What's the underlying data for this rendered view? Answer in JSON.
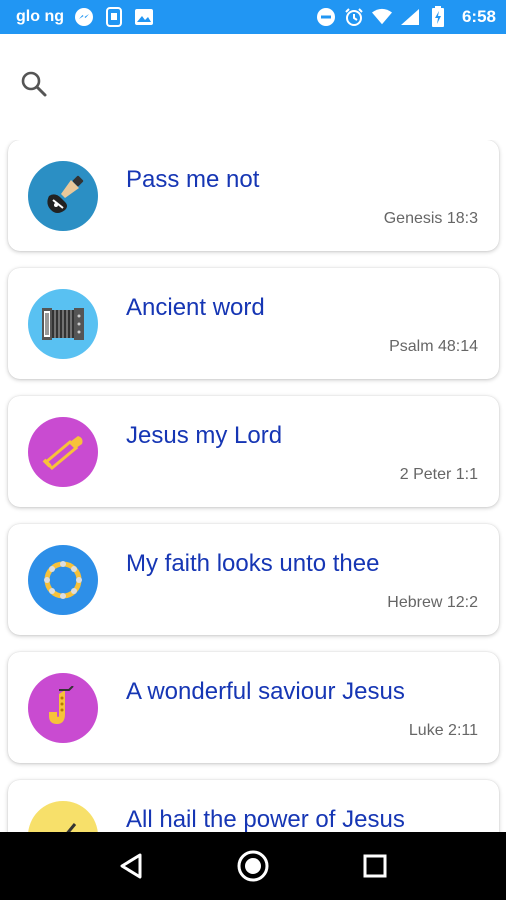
{
  "status_bar": {
    "carrier": "glo ng",
    "time": "6:58",
    "left_icons": [
      "messenger-icon",
      "sim-toolkit-icon",
      "image-icon"
    ],
    "right_icons": [
      "dnd-icon",
      "alarm-icon",
      "wifi-icon",
      "signal-icon",
      "battery-icon"
    ],
    "color": "#2196F3"
  },
  "search": {
    "icon": "search-icon"
  },
  "songs": [
    {
      "title": "Pass me not",
      "reference": "Genesis 18:3",
      "icon": "guitar-icon",
      "color": "#2b8fc4"
    },
    {
      "title": "Ancient word",
      "reference": "Psalm 48:14",
      "icon": "accordion-icon",
      "color": "#59c1f2"
    },
    {
      "title": "Jesus my Lord",
      "reference": "2 Peter 1:1",
      "icon": "trombone-icon",
      "color": "#c94bd1"
    },
    {
      "title": "My faith looks unto thee",
      "reference": "Hebrew 12:2",
      "icon": "tambourine-icon",
      "color": "#2d8fe8"
    },
    {
      "title": "A wonderful saviour Jesus",
      "reference": "Luke 2:11",
      "icon": "saxophone-icon",
      "color": "#c94bd1"
    },
    {
      "title": "All hail the power of Jesus",
      "reference": "",
      "icon": "flute-icon",
      "color": "#f7e06a"
    }
  ],
  "nav_bar": {
    "icons": [
      "back-icon",
      "home-icon",
      "recents-icon"
    ]
  }
}
